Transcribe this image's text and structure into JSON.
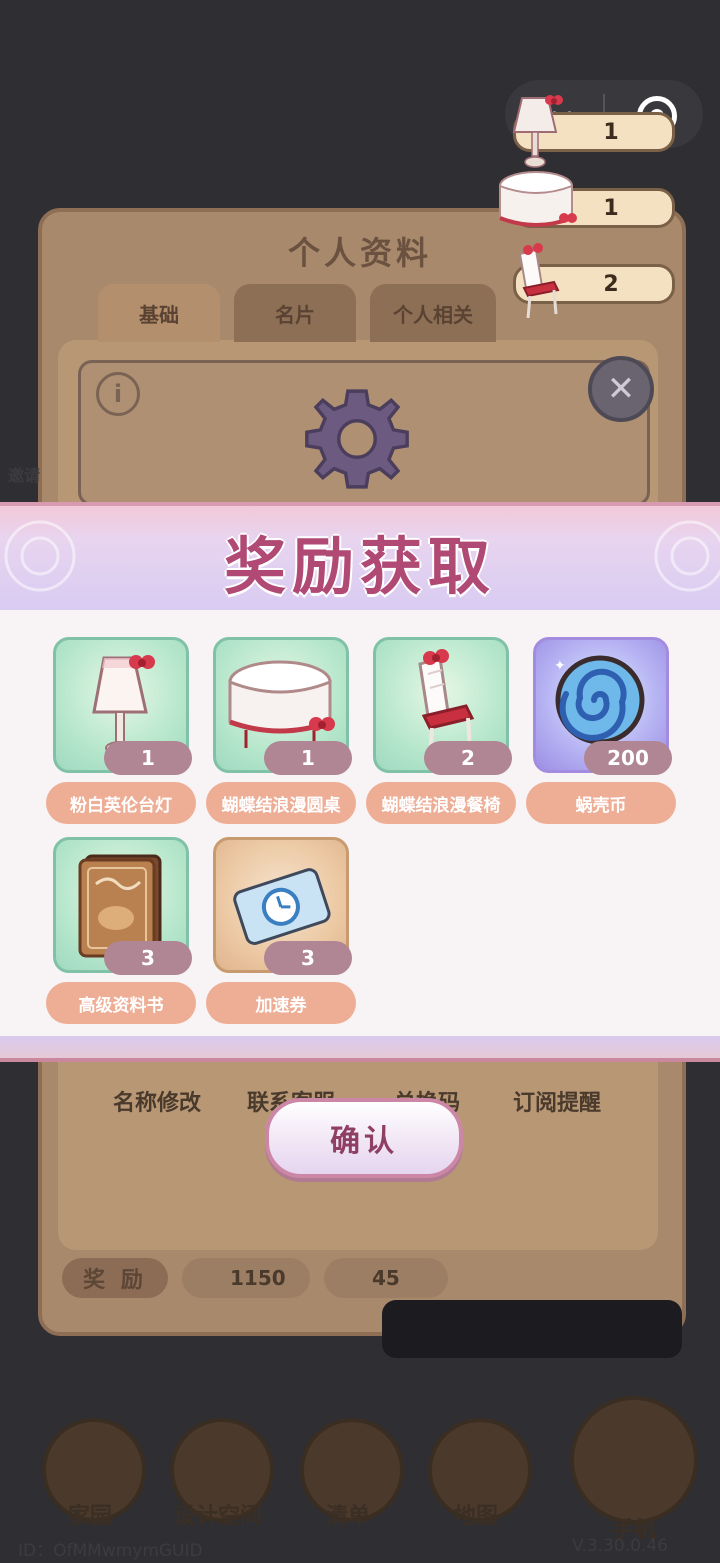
{
  "background": {
    "panel_title": "个人资料",
    "tabs": [
      "基础",
      "名片",
      "个人相关"
    ],
    "action_labels": [
      "名称修改",
      "联系客服",
      "兑换码",
      "订阅提醒"
    ],
    "reward_label": "奖 励",
    "currency_1": "1150",
    "currency_2": "45",
    "nav": [
      "家园",
      "设计空间",
      "清单",
      "地图",
      "手机"
    ],
    "user_id": "ID：OfMMwmymGUID",
    "version": "V.3.30.0.46",
    "side_invite": "邀请"
  },
  "fly_in": [
    {
      "icon": "table-lamp-icon",
      "count": "1"
    },
    {
      "icon": "round-table-icon",
      "count": "1"
    },
    {
      "icon": "chair-icon",
      "count": "2"
    }
  ],
  "reward": {
    "title": "奖励获取",
    "items": [
      {
        "name": "粉白英伦台灯",
        "qty": "1",
        "icon": "table-lamp-icon",
        "frame": "green"
      },
      {
        "name": "蝴蝶结浪漫圆桌",
        "qty": "1",
        "icon": "round-table-icon",
        "frame": "green"
      },
      {
        "name": "蝴蝶结浪漫餐椅",
        "qty": "2",
        "icon": "chair-icon",
        "frame": "green"
      },
      {
        "name": "蜗壳币",
        "qty": "200",
        "icon": "snail-shell-coin-icon",
        "frame": "purple"
      },
      {
        "name": "高级资料书",
        "qty": "3",
        "icon": "book-icon",
        "frame": "green"
      },
      {
        "name": "加速券",
        "qty": "3",
        "icon": "speed-ticket-icon",
        "frame": "tan"
      }
    ],
    "confirm_label": "确认"
  }
}
